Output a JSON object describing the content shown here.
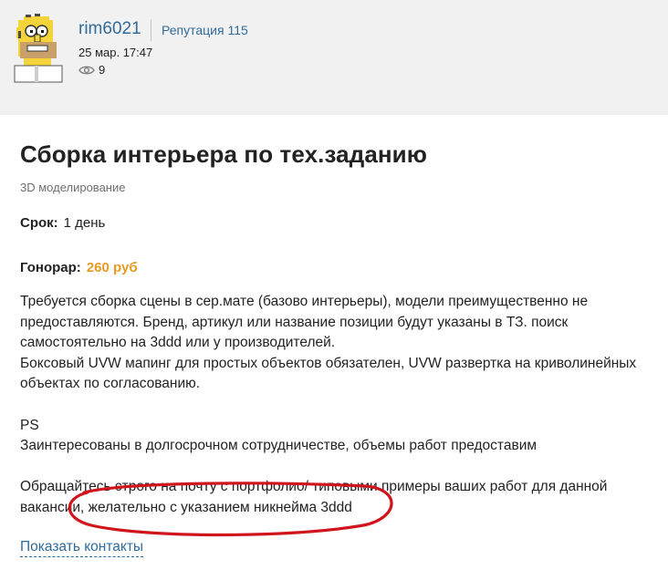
{
  "author": {
    "username": "rim6021",
    "reputation_label": "Репутация 115",
    "date": "25 мар. 17:47",
    "views": "9"
  },
  "post": {
    "title": "Сборка интерьера по тех.заданию",
    "category": "3D моделирование",
    "term_label": "Срок:",
    "term_value": "1 день",
    "fee_label": "Гонорар:",
    "fee_value": "260 руб",
    "description": [
      "Требуется сборка сцены в сер.мате (базово интерьеры), модели преимущественно не предоставляются. Бренд, артикул или название позиции будут указаны в ТЗ. поиск самостоятельно на 3ddd или у производителей.",
      "Боксовый UVW мапинг для простых объектов обязателен, UVW развертка на криволинейных объектах по согласованию.",
      "",
      "PS",
      "Заинтересованы в долгосрочном сотрудничестве, объемы работ предоставим",
      "",
      "Обращайтесь строго на почту с портфолио/ типовыми примеры ваших работ для данной вакансии, желательно с указанием никнейма 3ddd"
    ],
    "show_contacts_label": "Показать контакты"
  },
  "colors": {
    "header_bg": "#f1f1f1",
    "link": "#2f6b9a",
    "fee": "#e79a21",
    "annotation": "#d0151c"
  },
  "icons": {
    "views": "eye-icon",
    "avatar": "homer-avatar"
  }
}
